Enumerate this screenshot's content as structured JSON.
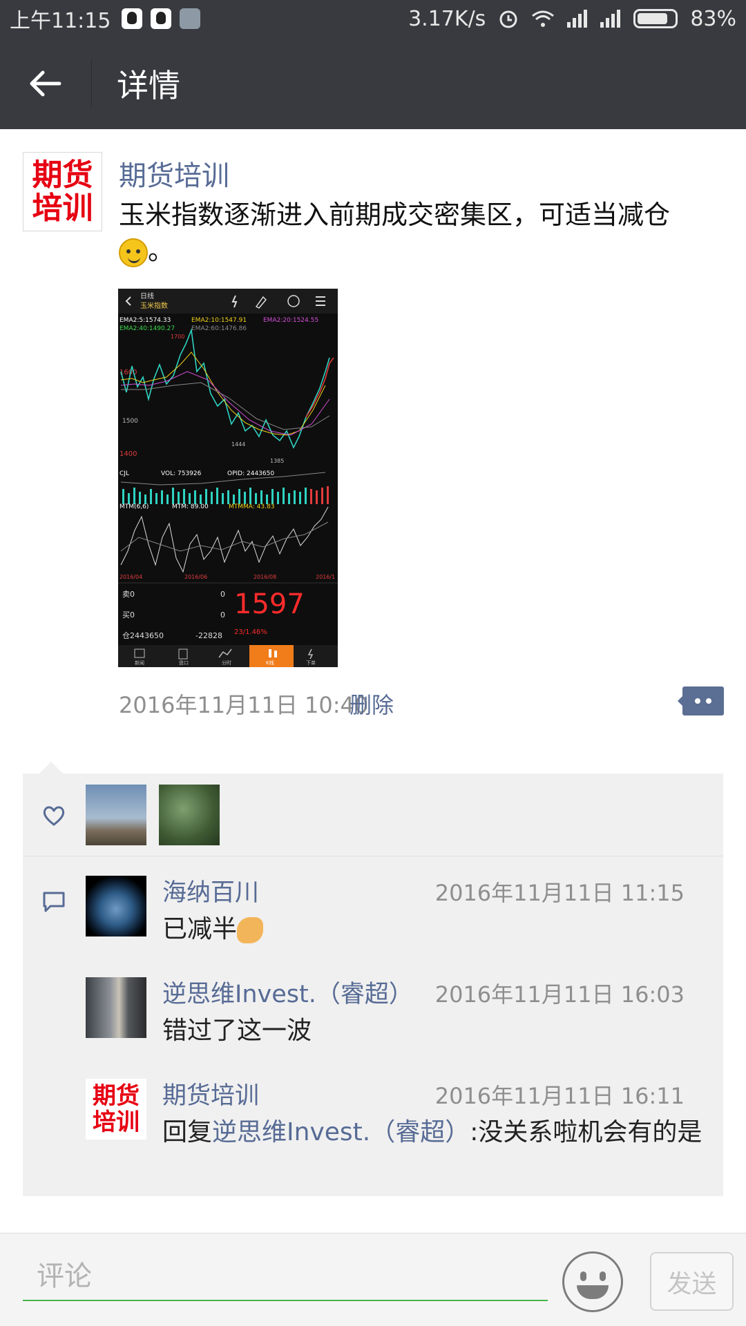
{
  "status_bar": {
    "time": "上午11:15",
    "speed": "3.17K/s",
    "battery": "83%"
  },
  "header": {
    "title": "详情",
    "back_icon": "back-arrow-icon"
  },
  "post": {
    "author": "期货培训",
    "avatar_text_line1": "期货",
    "avatar_text_line2": "培训",
    "text": "玉米指数逐渐进入前期成交密集区，可适当减仓",
    "text_suffix": "。",
    "timestamp": "2016年11月11日 10:40",
    "delete_label": "删除",
    "image": {
      "period": "日线",
      "name": "玉米指数",
      "ema_1": "EMA2:5:1574.33",
      "ema_2": "EMA2:10:1547.91",
      "ema_3": "EMA2:20:1524.55",
      "ema_4": "EMA2:40:1490.27",
      "ema_5": "EMA2:60:1476.86",
      "level_1700": "1700",
      "level_1600": "1600",
      "level_1500": "1500",
      "level_1400": "1400",
      "low_1444": "1444",
      "low_1385": "1385",
      "vol_label": "CJL",
      "vol": "VOL: 753926",
      "opid": "OPID: 2443650",
      "mtm_label": "MTM(6,6)",
      "mtm": "MTM: 89.00",
      "mtmma": "MTMMA: 43.83",
      "dates": [
        "2016/04",
        "2016/06",
        "2016/08",
        "2016/1"
      ],
      "sell_label": "卖0",
      "sell_val": "0",
      "buy_label": "买0",
      "buy_val": "0",
      "pos_label": "仓2443650",
      "pos_change": "-22828",
      "price": "1597",
      "change": "23/1.46%",
      "tabs": [
        "新闻",
        "盘口",
        "分时",
        "K线",
        "下单"
      ]
    }
  },
  "likes": {
    "icon": "heart-icon"
  },
  "comments": [
    {
      "name": "海纳百川",
      "time": "2016年11月11日 11:15",
      "text": "已减半"
    },
    {
      "name": "逆思维Invest.（睿超）",
      "time": "2016年11月11日 16:03",
      "text": "错过了这一波"
    },
    {
      "name": "期货培训",
      "time": "2016年11月11日 16:11",
      "reply_prefix": "回复",
      "reply_to": "逆思维Invest.（睿超）",
      "text": ":没关系啦机会有的是",
      "avatar_text_line1": "期货",
      "avatar_text_line2": "培训"
    }
  ],
  "bottom_bar": {
    "placeholder": "评论",
    "send_label": "发送"
  }
}
